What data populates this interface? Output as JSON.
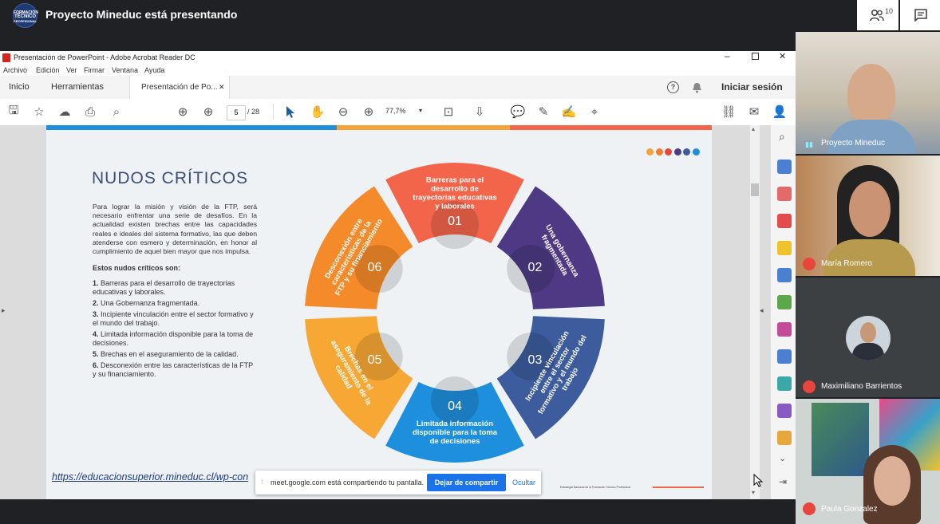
{
  "meet": {
    "title": "Proyecto Mineduc está presentando",
    "logo_text": [
      "FORMACIÓN",
      "TÉCNICO",
      "PROFESIONAL"
    ],
    "participant_count": "10",
    "share_bar": {
      "text": "meet.google.com está compartiendo tu pantalla.",
      "stop_label": "Dejar de compartir",
      "hide_label": "Ocultar"
    },
    "participants": [
      {
        "name": "Proyecto Mineduc"
      },
      {
        "name": "María Romero"
      },
      {
        "name": "Maximiliano Barrientos"
      },
      {
        "name": "Paula Gonzalez"
      }
    ]
  },
  "acrobat": {
    "window_title": "Presentación de PowerPoint - Adobe Acrobat Reader DC",
    "menu": [
      "Archivo",
      "Edición",
      "Ver",
      "Firmar",
      "Ventana",
      "Ayuda"
    ],
    "tabs": {
      "home": "Inicio",
      "tools": "Herramientas",
      "doc": "Presentación de Po..."
    },
    "signin": "Iniciar sesión",
    "page_current": "5",
    "page_total": "/ 28",
    "zoom": "77,7%"
  },
  "slide": {
    "title": "NUDOS CRÍTICOS",
    "intro": "Para lograr la misión y visión de la FTP, será necesario enfrentar una serie de desafíos. En la actualidad existen brechas entre las capacidades reales e ideales del sistema formativo, las que deben atenderse con esmero y determinación, en honor al cumplimiento de aquel bien mayor que nos impulsa.",
    "subtitle": "Estos nudos críticos son:",
    "list": [
      {
        "n": "1.",
        "t": "Barreras para el desarrollo de trayectorias educativas y laborales."
      },
      {
        "n": "2.",
        "t": "Una Gobernanza fragmentada."
      },
      {
        "n": "3.",
        "t": "Incipiente vinculación entre el sector formativo y el mundo del trabajo."
      },
      {
        "n": "4.",
        "t": "Limitada información disponible para la toma de decisiones."
      },
      {
        "n": "5.",
        "t": "Brechas en el aseguramiento de la calidad."
      },
      {
        "n": "6.",
        "t": "Desconexión entre las características de la FTP y su financiamiento."
      }
    ],
    "link": "https://educacionsuperior.mineduc.cl/wp-con",
    "footer_small": "Estrategia Nacional de la Formación Técnico Profesional",
    "segments": [
      {
        "num": "01",
        "text": "Barreras para el desarrollo de trayectorias educativas y laborales",
        "color": "#f2654a"
      },
      {
        "num": "02",
        "text": "Una gobernanza fragmentada",
        "color": "#4e3a84"
      },
      {
        "num": "03",
        "text": "Incipiente vinculación entre el sector formativo y el mundo del trabajo",
        "color": "#3c5c9e"
      },
      {
        "num": "04",
        "text": "Limitada información disponible para la toma de decisiones",
        "color": "#1e8fdc"
      },
      {
        "num": "05",
        "text": "Brechas en el aseguramiento de la calidad",
        "color": "#f7a734"
      },
      {
        "num": "06",
        "text": "Desconexión entre características de la FTP y su financiamiento",
        "color": "#f58a2a"
      }
    ],
    "dot_colors": [
      "#f2a33a",
      "#f47b35",
      "#e8453c",
      "#4e3a84",
      "#3c5c9e",
      "#1e8fdc"
    ],
    "top_bar_colors": [
      "#1e8fdc",
      "#f2a33a",
      "#f2654a"
    ]
  }
}
